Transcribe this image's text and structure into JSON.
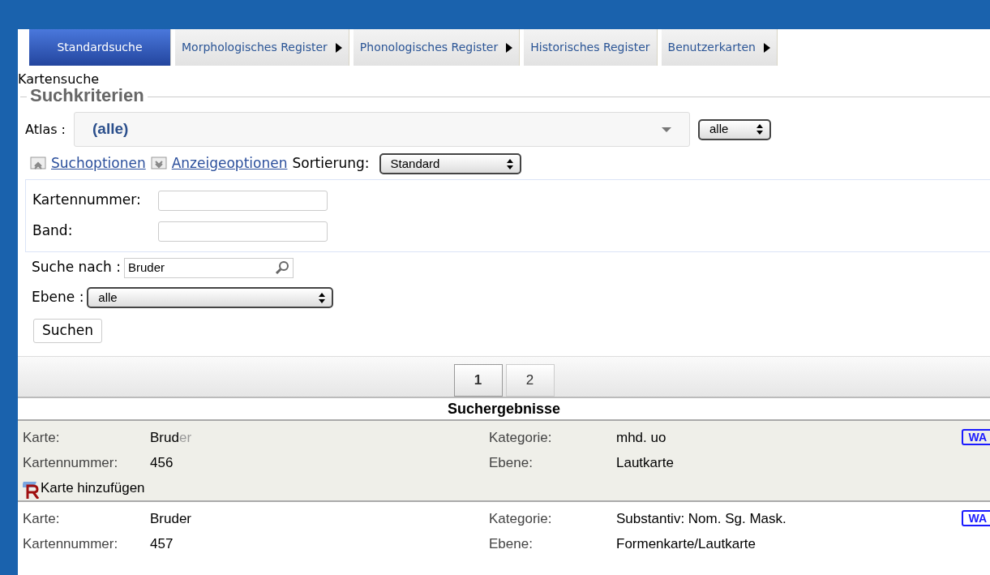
{
  "tabs": [
    {
      "label": "Standardsuche",
      "selected": true,
      "submenu": false
    },
    {
      "label": "Morphologisches Register",
      "selected": false,
      "submenu": true
    },
    {
      "label": "Phonologisches Register",
      "selected": false,
      "submenu": true
    },
    {
      "label": "Historisches Register",
      "selected": false,
      "submenu": false
    },
    {
      "label": "Benutzerkarten",
      "selected": false,
      "submenu": true
    }
  ],
  "page_title": "Kartensuche",
  "criteria": {
    "legend": "Suchkriterien",
    "atlas": {
      "label": "Atlas :",
      "value": "(alle)",
      "filter": "alle"
    },
    "options": [
      {
        "label": "Suchoptionen",
        "kind": "up"
      },
      {
        "label": "Anzeigeoptionen",
        "kind": "down"
      }
    ],
    "sort": {
      "label": "Sortierung:",
      "value": "Standard"
    },
    "fields": [
      {
        "label": "Kartennummer:"
      },
      {
        "label": "Band:"
      }
    ],
    "search": {
      "label": "Suche nach :",
      "value": "Bruder"
    },
    "level": {
      "label": "Ebene :",
      "value": "alle"
    },
    "submit": "Suchen"
  },
  "pages": [
    {
      "label": "1",
      "selected": true
    },
    {
      "label": "2",
      "selected": false
    }
  ],
  "results": {
    "title": "Suchergebnisse",
    "items": [
      {
        "highlighted": true,
        "karte_label": "Karte:",
        "karte": [
          {
            "text": "Brud",
            "dim": false
          },
          {
            "text": "er",
            "dim": true
          }
        ],
        "nummer_label": "Kartennummer:",
        "nummer": "456",
        "kategorie_label": "Kategorie:",
        "kategorie": "mhd. uo",
        "ebene_label": "Ebene:",
        "ebene": "Lautkarte",
        "tag": "WA",
        "add": "Karte hinzufügen"
      },
      {
        "highlighted": false,
        "karte_label": "Karte:",
        "karte": [
          {
            "text": "Bruder",
            "dim": false
          }
        ],
        "nummer_label": "Kartennummer:",
        "nummer": "457",
        "kategorie_label": "Kategorie:",
        "kategorie": "Substantiv: Nom. Sg. Mask.",
        "ebene_label": "Ebene:",
        "ebene": "Formenkarte/Lautkarte",
        "tag": "WA"
      }
    ]
  }
}
